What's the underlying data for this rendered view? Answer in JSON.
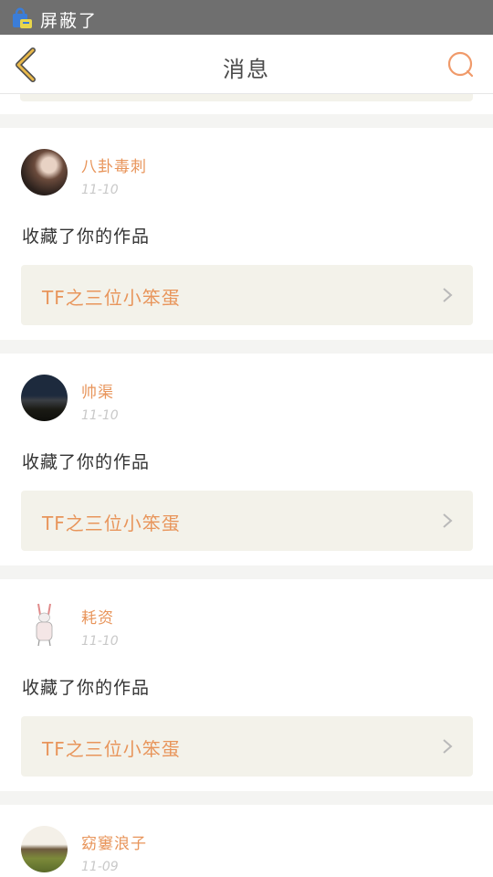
{
  "status_bar": {
    "text": "屏蔽了",
    "icon": "notification-bag-icon"
  },
  "nav": {
    "title": "消息",
    "back_icon": "chevron-left-icon",
    "chat_icon": "chat-bubble-icon"
  },
  "notifications": [
    {
      "user": "八卦毒刺",
      "date": "11-10",
      "action": "收藏了你的作品",
      "work_title": "TF之三位小笨蛋",
      "avatar": "photo-avatar-portrait"
    },
    {
      "user": "帅渠",
      "date": "11-10",
      "action": "收藏了你的作品",
      "work_title": "TF之三位小笨蛋",
      "avatar": "photo-avatar-night-landscape"
    },
    {
      "user": "耗资",
      "date": "11-10",
      "action": "收藏了你的作品",
      "work_title": "TF之三位小笨蛋",
      "avatar": "photo-avatar-rabbit-doll"
    },
    {
      "user": "窈窶浪子",
      "date": "11-09",
      "action": "",
      "work_title": "",
      "avatar": "photo-avatar-outdoor"
    }
  ],
  "colors": {
    "accent": "#e8955b",
    "nav_icon": "#e8b84a",
    "status_bar": "#6f6f6f",
    "card_bg": "#ffffff",
    "page_bg": "#f4f4f2",
    "work_bg": "#f3f2ea"
  }
}
